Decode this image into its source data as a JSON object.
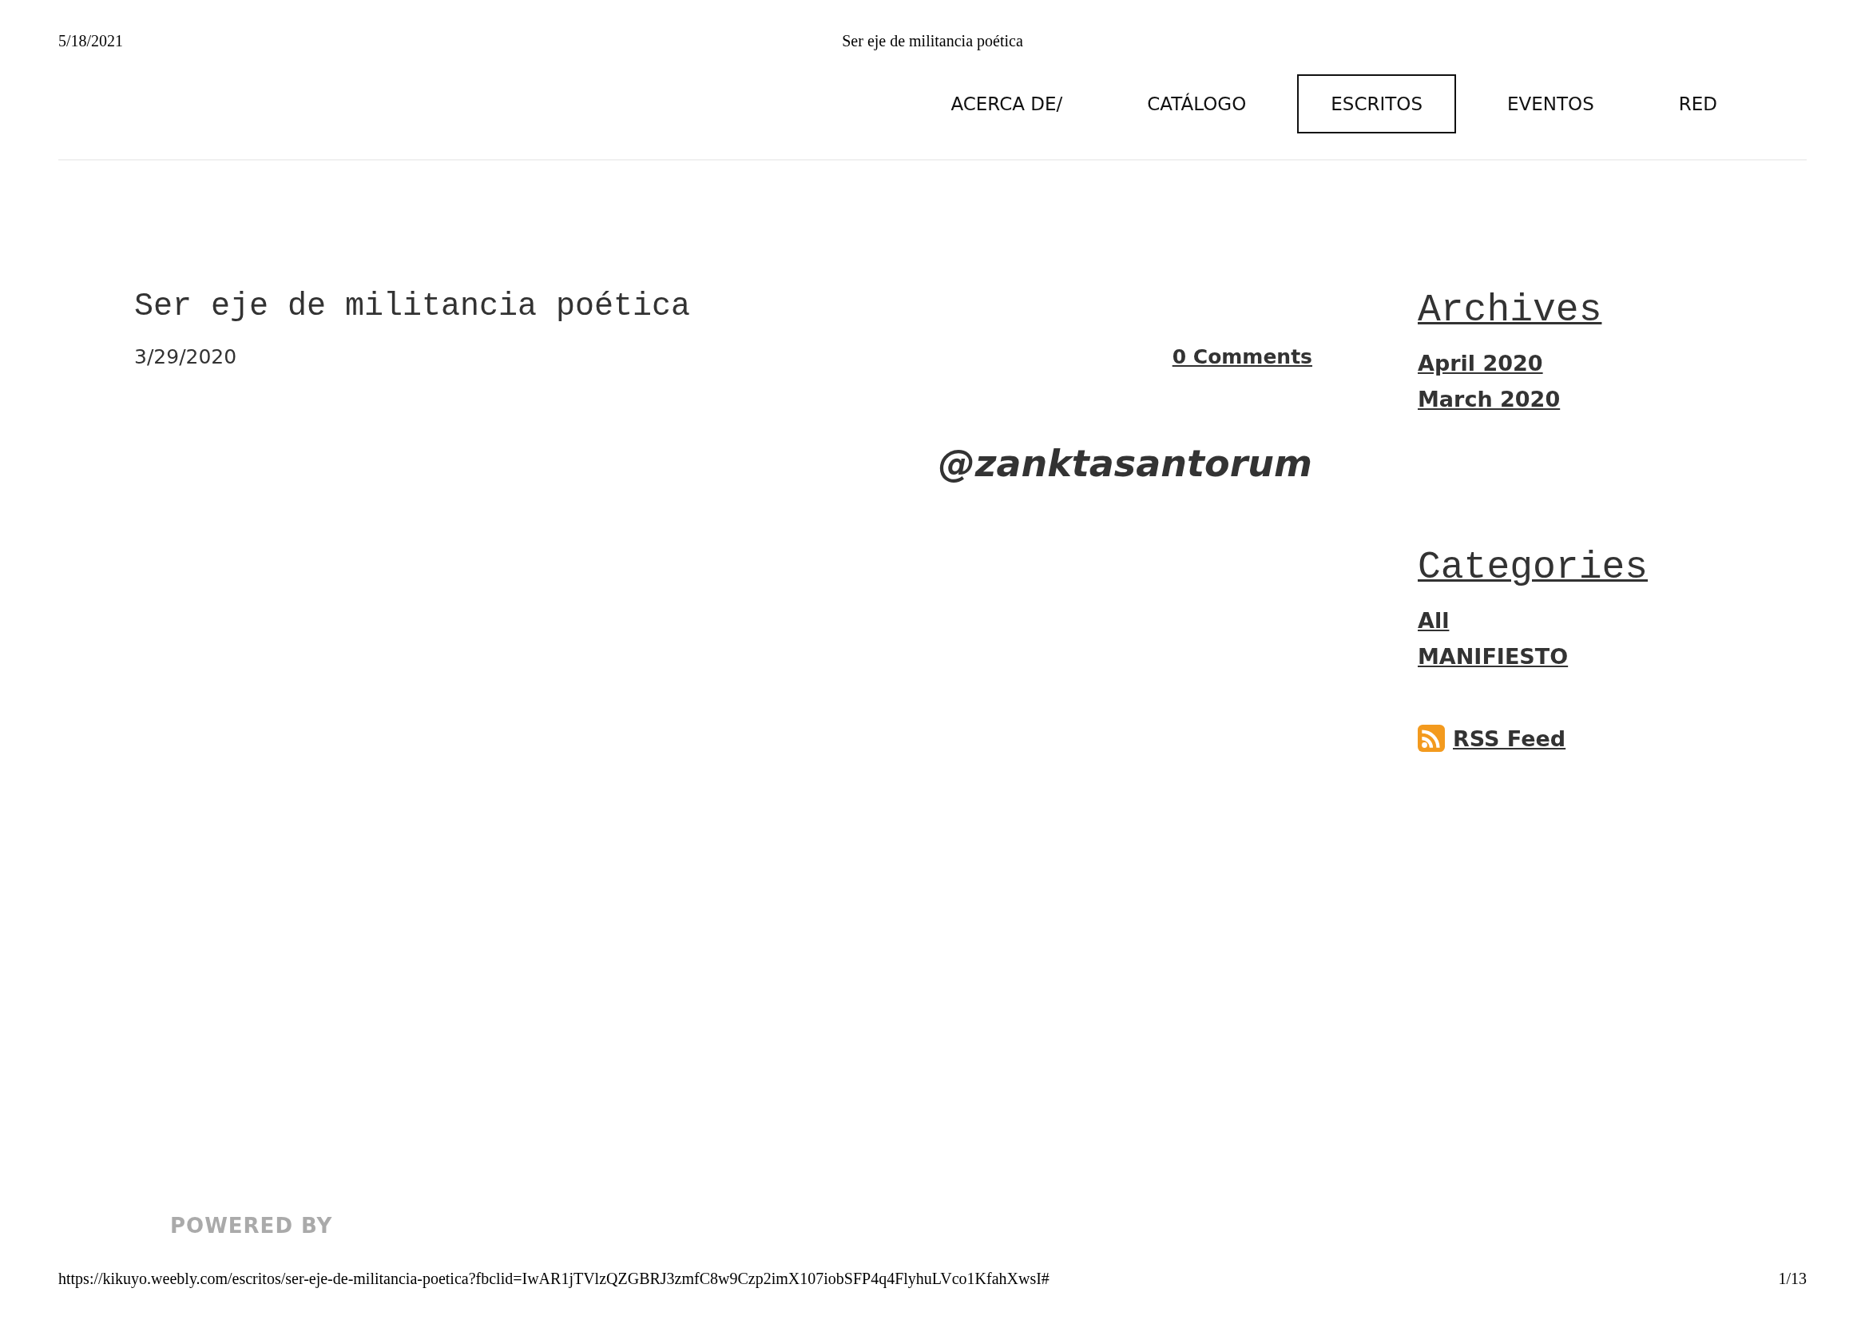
{
  "print_header": {
    "date": "5/18/2021",
    "title": "Ser eje de militancia poética"
  },
  "nav": [
    {
      "label": "ACERCA DE/",
      "selected": false
    },
    {
      "label": "CATÁLOGO",
      "selected": false
    },
    {
      "label": "ESCRITOS",
      "selected": true
    },
    {
      "label": "EVENTOS",
      "selected": false
    },
    {
      "label": "RED",
      "selected": false
    }
  ],
  "post": {
    "title": "Ser eje de militancia poética",
    "date": "3/29/2020",
    "comments": "0 Comments",
    "handle": "@zanktasantorum"
  },
  "sidebar": {
    "archives": {
      "heading": "Archives",
      "items": [
        "April 2020",
        "March 2020"
      ]
    },
    "categories": {
      "heading": "Categories",
      "items": [
        "All",
        "MANIFIESTO"
      ]
    },
    "rss": "RSS Feed"
  },
  "powered_by": "POWERED BY",
  "print_footer": {
    "url": "https://kikuyo.weebly.com/escritos/ser-eje-de-militancia-poetica?fbclid=IwAR1jTVlzQZGBRJ3zmfC8w9Czp2imX107iobSFP4q4FlyhuLVco1KfahXwsI#",
    "page": "1/13"
  }
}
